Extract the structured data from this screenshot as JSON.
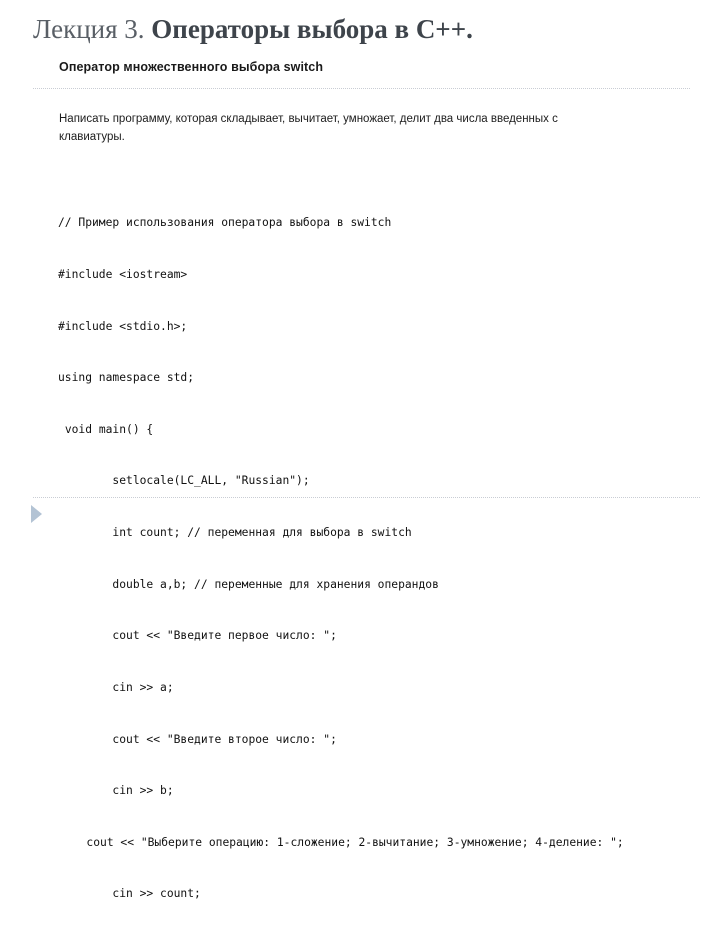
{
  "slide": {
    "title": {
      "lead": "Лекция 3. ",
      "main": "Операторы выбора в C++."
    },
    "subtitle": "Оператор множественного выбора switch",
    "body_text": "Написать программу, которая складывает, вычитает, умножает, делит два числа введенных с клавиатуры.",
    "code_lines": [
      "// Пример использования оператора выбора в switch",
      "#include <iostream>",
      "#include <stdio.h>;",
      "using namespace std;",
      " void main() {",
      "        setlocale(LC_ALL, \"Russian\");",
      "        int count; // переменная для выбора в switch",
      "        double a,b; // переменные для хранения операндов",
      "        cout << \"Введите первое число: \";",
      "        cin >> a;",
      "        cout << \"Введите второе число: \";",
      "        cin >> b;",
      "        cout << \"Выберите операцию: 1-сложение; 2-вычитание; 3-умножение; 4-деление: \";",
      "        cin >> count;"
    ],
    "nav": {
      "next_icon": "play-triangle-icon"
    },
    "colors": {
      "title_lead": "#595f66",
      "title_main": "#3e444b",
      "divider": "#c9cdd4",
      "triangle": "#b3c3d4",
      "body": "#1c1c1c",
      "background": "#ffffff"
    }
  }
}
